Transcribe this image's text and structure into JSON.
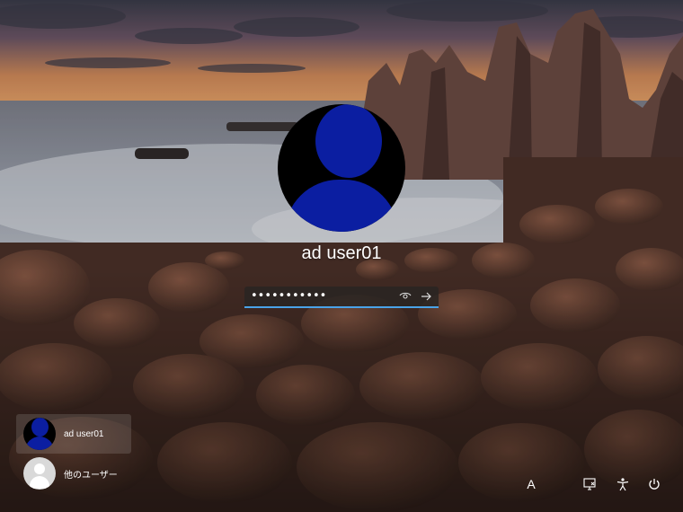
{
  "login": {
    "display_name": "ad user01",
    "password_masked": "•••••••••••",
    "show_password_icon": "eye-icon",
    "submit_icon": "arrow-right-icon",
    "accent_color": "#4aa3e8",
    "avatar_color": "#0b1ea1"
  },
  "user_list": {
    "items": [
      {
        "label": "ad user01",
        "icon": "user-avatar-blue",
        "selected": true
      },
      {
        "label": "他のユーザー",
        "icon": "user-avatar-generic",
        "selected": false
      }
    ]
  },
  "system_tray": {
    "language_indicator": "A",
    "network_icon": "network-icon",
    "accessibility_icon": "accessibility-icon",
    "power_icon": "power-icon"
  }
}
